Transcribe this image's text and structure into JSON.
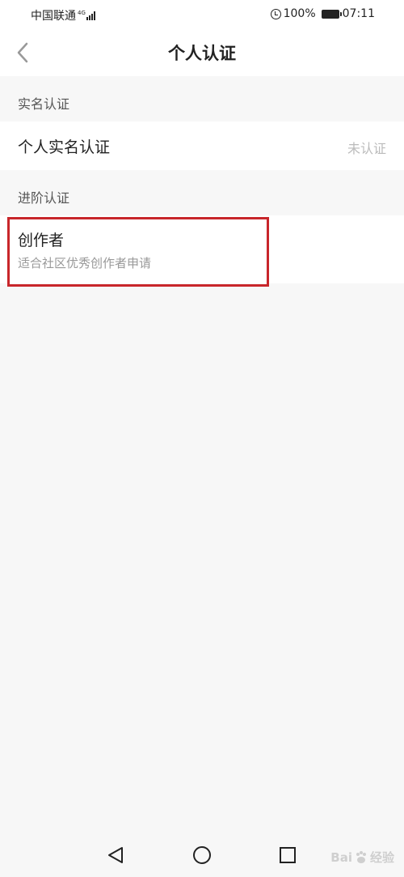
{
  "status_bar": {
    "carrier": "中国联通",
    "network_type": "4G",
    "battery_percent": "100%",
    "time": "07:11",
    "icons": [
      "signal-icon",
      "alarm-icon",
      "battery-icon"
    ]
  },
  "header": {
    "title": "个人认证",
    "back_icon": "chevron-left-icon"
  },
  "sections": [
    {
      "header": "实名认证",
      "items": [
        {
          "title": "个人实名认证",
          "status": "未认证"
        }
      ]
    },
    {
      "header": "进阶认证",
      "items": [
        {
          "title": "创作者",
          "subtitle": "适合社区优秀创作者申请",
          "highlighted": true
        }
      ]
    }
  ],
  "bottom_nav": {
    "buttons": [
      "back-triangle-icon",
      "home-circle-icon",
      "recents-square-icon"
    ]
  },
  "watermark": {
    "brand_left": "Bai",
    "brand_right": "经验",
    "icon": "baidu-paw-icon"
  },
  "colors": {
    "highlight": "#c8262b",
    "background": "#f7f7f7",
    "card": "#ffffff"
  }
}
